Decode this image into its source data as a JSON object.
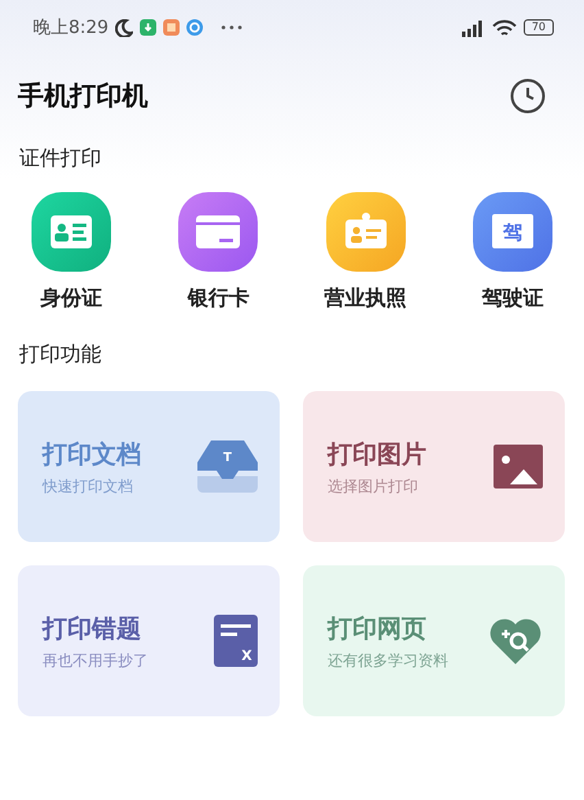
{
  "status_bar": {
    "time": "晚上8:29",
    "battery": "70"
  },
  "header": {
    "title": "手机打印机"
  },
  "sections": [
    {
      "title": "证件打印"
    },
    {
      "title": "打印功能"
    }
  ],
  "id_items": [
    {
      "kind": "id",
      "label": "身份证"
    },
    {
      "kind": "bank",
      "label": "银行卡"
    },
    {
      "kind": "license",
      "label": "营业执照"
    },
    {
      "kind": "driver",
      "label": "驾驶证",
      "icon_text": "驾"
    }
  ],
  "cards": [
    {
      "kind": "document",
      "title": "打印文档",
      "subtitle": "快速打印文档",
      "icon_text": "T"
    },
    {
      "kind": "image",
      "title": "打印图片",
      "subtitle": "选择图片打印"
    },
    {
      "kind": "mistakes",
      "title": "打印错题",
      "subtitle": "再也不用手抄了",
      "icon_text": "X"
    },
    {
      "kind": "webpage",
      "title": "打印网页",
      "subtitle": "还有很多学习资料"
    }
  ]
}
